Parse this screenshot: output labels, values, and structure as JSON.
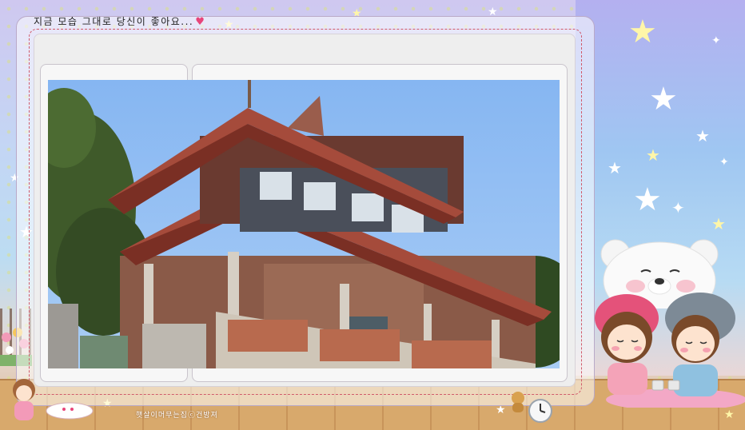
{
  "frame": {
    "title": "지금 모습 그대로 당신이 좋아요...",
    "footer_credit": "햇살이머무는집ⓒ건방져"
  },
  "photo": {
    "subject": "temple-pavilion"
  },
  "colors": {
    "sky": "#8fbcf2",
    "roof": "#a54b3b",
    "dash_border": "#d05a6a"
  },
  "icons": [
    "heart-icon",
    "star-icon",
    "bear-icon",
    "couple-illustration",
    "alarm-clock-icon"
  ]
}
